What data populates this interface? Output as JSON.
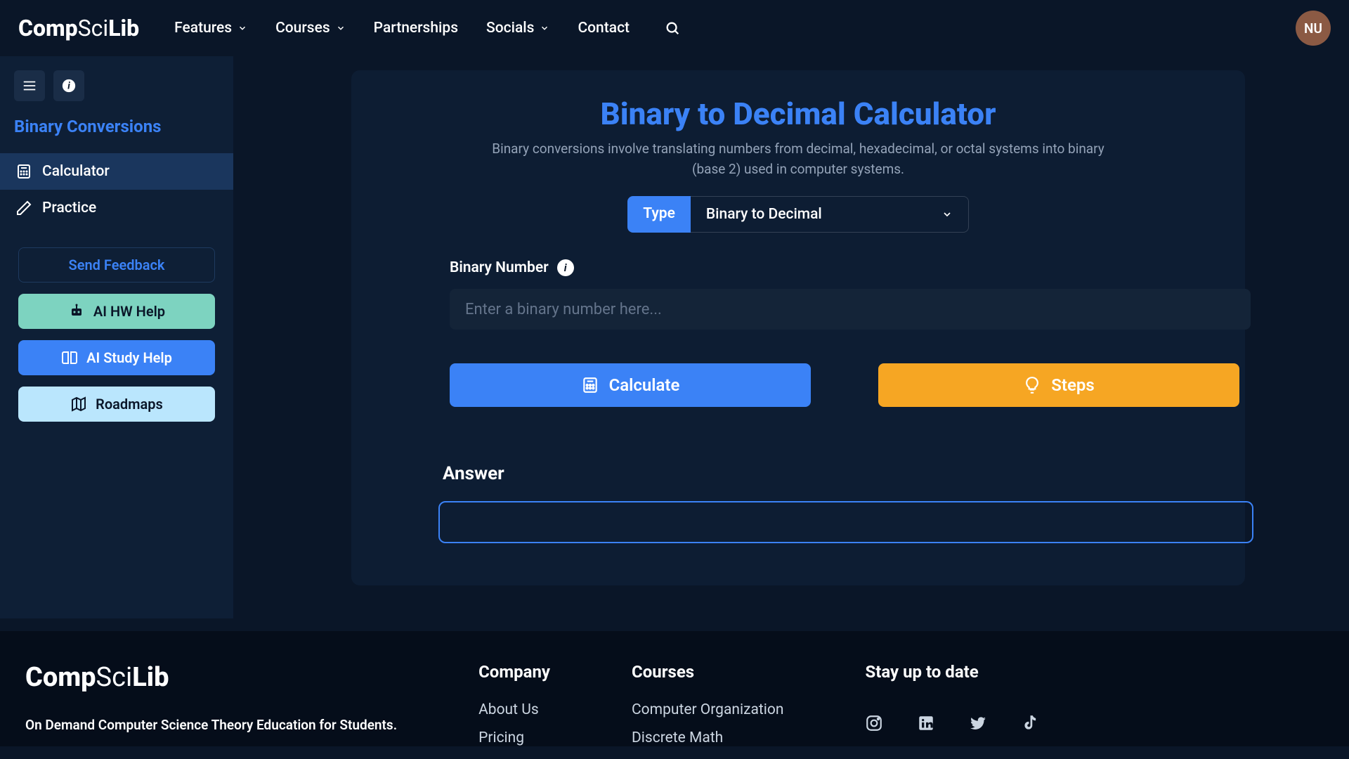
{
  "brand": {
    "part1": "Comp",
    "part2": "Sci",
    "part3": "Lib"
  },
  "nav": {
    "features": "Features",
    "courses": "Courses",
    "partnerships": "Partnerships",
    "socials": "Socials",
    "contact": "Contact"
  },
  "avatar": "NU",
  "sidebar": {
    "title": "Binary Conversions",
    "calculator": "Calculator",
    "practice": "Practice",
    "feedback": "Send Feedback",
    "hw": "AI HW Help",
    "study": "AI Study Help",
    "roadmaps": "Roadmaps"
  },
  "main": {
    "title": "Binary to Decimal Calculator",
    "subtitle": "Binary conversions involve translating numbers from decimal, hexadecimal, or octal systems into binary (base 2) used in computer systems.",
    "type_label": "Type",
    "type_value": "Binary to Decimal",
    "field_label": "Binary Number",
    "placeholder": "Enter a binary number here...",
    "calculate": "Calculate",
    "steps": "Steps",
    "answer_label": "Answer"
  },
  "footer": {
    "tag": "On Demand Computer Science Theory Education for Students.",
    "company_head": "Company",
    "about": "About Us",
    "pricing": "Pricing",
    "courses_head": "Courses",
    "course1": "Computer Organization",
    "course2": "Discrete Math",
    "stay_head": "Stay up to date"
  }
}
